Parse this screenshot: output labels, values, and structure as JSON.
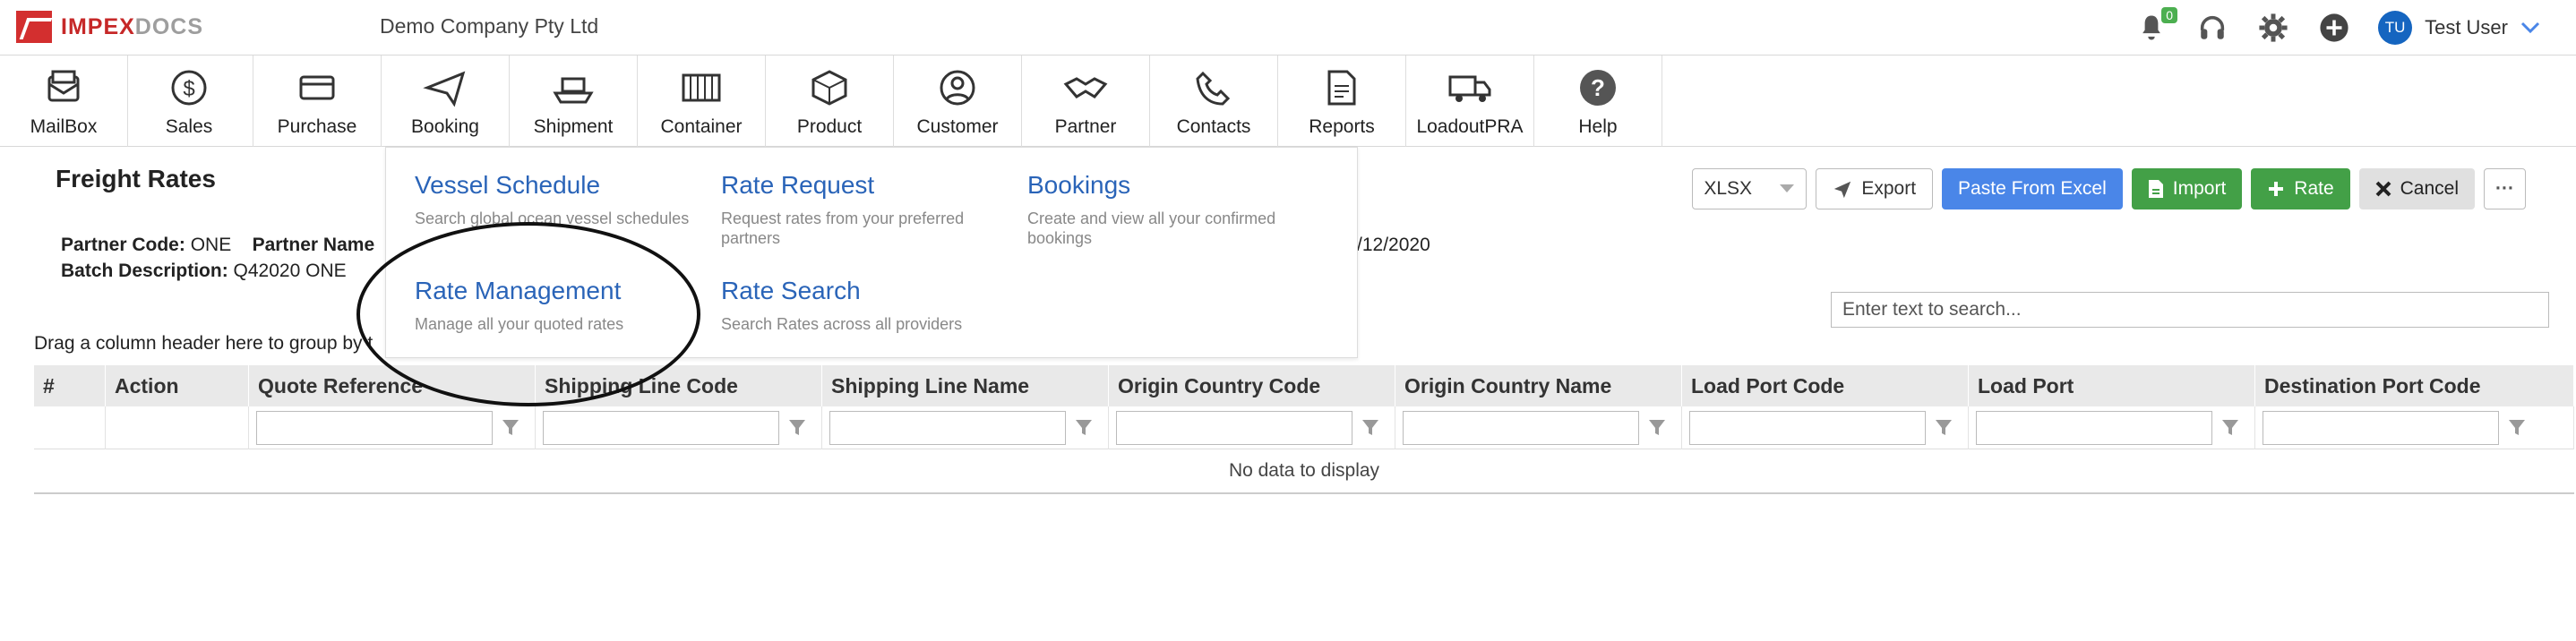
{
  "app": {
    "brand_a": "IMPEX",
    "brand_b": "DOCS",
    "company": "Demo Company Pty Ltd"
  },
  "header": {
    "notification_count": "0",
    "user_initials": "TU",
    "user_name": "Test User"
  },
  "modules": [
    {
      "label": "MailBox",
      "icon": "mailbox-icon"
    },
    {
      "label": "Sales",
      "icon": "dollar-icon"
    },
    {
      "label": "Purchase",
      "icon": "card-icon"
    },
    {
      "label": "Booking",
      "icon": "paper-plane-icon"
    },
    {
      "label": "Shipment",
      "icon": "ship-icon"
    },
    {
      "label": "Container",
      "icon": "container-icon"
    },
    {
      "label": "Product",
      "icon": "box-icon"
    },
    {
      "label": "Customer",
      "icon": "person-icon"
    },
    {
      "label": "Partner",
      "icon": "handshake-icon"
    },
    {
      "label": "Contacts",
      "icon": "phone-icon"
    },
    {
      "label": "Reports",
      "icon": "report-icon"
    },
    {
      "label": "LoadoutPRA",
      "icon": "truck-icon"
    },
    {
      "label": "Help",
      "icon": "help-icon"
    }
  ],
  "page": {
    "title": "Freight Rates",
    "partner_code_label": "Partner Code:",
    "partner_code": "ONE",
    "partner_name_label": "Partner Name",
    "batch_label": "Batch Description:",
    "batch_value": "Q42020 ONE",
    "date_partial": "/12/2020",
    "group_hint": "Drag a column header here to group by t",
    "search_placeholder": "Enter text to search...",
    "no_data": "No data to display"
  },
  "toolbar": {
    "format": "XLSX",
    "export": "Export",
    "paste": "Paste From Excel",
    "import": "Import",
    "rate": "Rate",
    "cancel": "Cancel",
    "more": "···"
  },
  "grid": {
    "columns": [
      "#",
      "Action",
      "Quote Reference",
      "Shipping Line Code",
      "Shipping Line Name",
      "Origin Country Code",
      "Origin Country Name",
      "Load Port Code",
      "Load Port",
      "Destination Port Code"
    ]
  },
  "dropdown": [
    {
      "title": "Vessel Schedule",
      "desc": "Search global ocean vessel schedules"
    },
    {
      "title": "Rate Request",
      "desc": "Request rates from your preferred partners"
    },
    {
      "title": "Bookings",
      "desc": "Create and view all your confirmed bookings"
    },
    {
      "title": "Rate Management",
      "desc": "Manage all your quoted rates"
    },
    {
      "title": "Rate Search",
      "desc": "Search Rates across all providers"
    }
  ],
  "colors": {
    "brand_red": "#c62828",
    "link_blue": "#2a64b8",
    "primary": "#4a86e8",
    "success": "#43a047"
  }
}
